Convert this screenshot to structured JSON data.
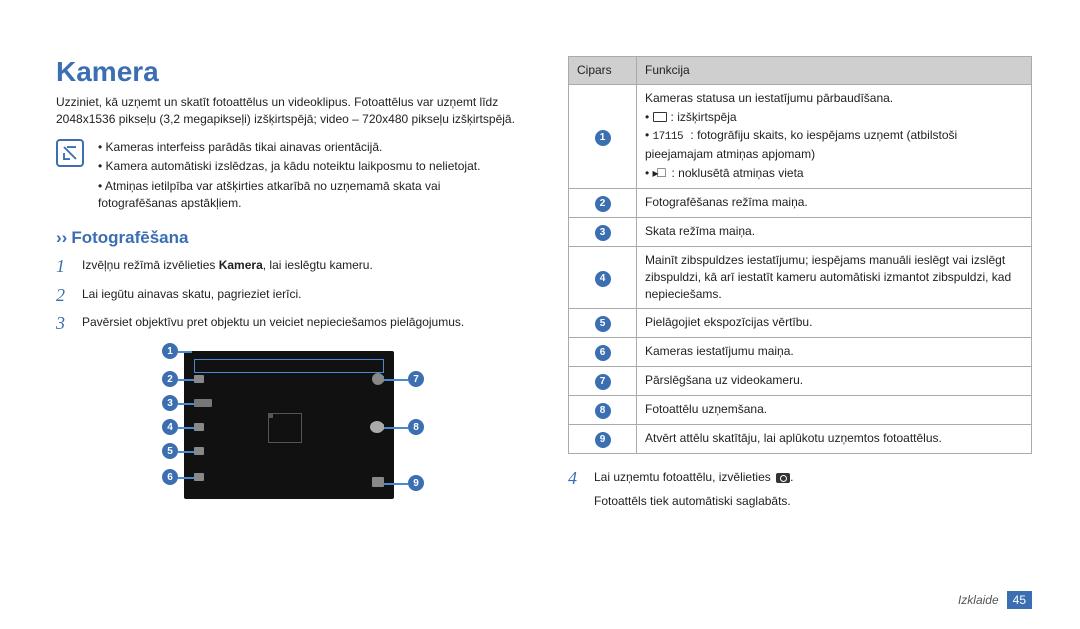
{
  "title": "Kamera",
  "intro": "Uzziniet, kā uzņemt un skatīt fotoattēlus un videoklipus. Fotoattēlus var uzņemt līdz 2048x1536 pikseļu (3,2 megapikseļi) izšķirtspējā; video – 720x480 pikseļu izšķirtspējā.",
  "notes": [
    "Kameras interfeiss parādās tikai ainavas orientācijā.",
    "Kamera automātiski izslēdzas, ja kādu noteiktu laikposmu to nelietojat.",
    "Atmiņas ietilpība var atšķirties atkarībā no uzņemamā skata vai fotografēšanas apstākļiem."
  ],
  "section_title": "Fotografēšana",
  "steps": {
    "s1_num": "1",
    "s1_a": "Izvēļņu režīmā izvēlieties ",
    "s1_bold": "Kamera",
    "s1_b": ", lai ieslēgtu kameru.",
    "s2_num": "2",
    "s2": "Lai iegūtu ainavas skatu, pagrieziet ierīci.",
    "s3_num": "3",
    "s3": "Pavērsiet objektīvu pret objektu un veiciet nepieciešamos pielāgojumus.",
    "s4_num": "4",
    "s4_a": "Lai uzņemtu fotoattēlu, izvēlieties ",
    "s4_b": ".",
    "s4_after": "Fotoattēls tiek automātiski saglabāts."
  },
  "table": {
    "h1": "Cipars",
    "h2": "Funkcija",
    "r1_badge": "1",
    "r1_main": "Kameras statusa un iestatījumu pārbaudīšana.",
    "r1_sub1_after": ": izšķirtspēja",
    "r1_sub2_num": "17115",
    "r1_sub2_after": " : fotogrāfiju skaits, ko iespējams uzņemt (atbilstoši pieejamajam atmiņas apjomam)",
    "r1_sub3_after": " : noklusētā atmiņas vieta",
    "r2_badge": "2",
    "r2": "Fotografēšanas režīma maiņa.",
    "r3_badge": "3",
    "r3": "Skata režīma maiņa.",
    "r4_badge": "4",
    "r4": "Mainīt zibspuldzes iestatījumu; iespējams manuāli ieslēgt vai izslēgt zibspuldzi, kā arī iestatīt kameru automātiski izmantot zibspuldzi, kad nepieciešams.",
    "r5_badge": "5",
    "r5": "Pielāgojiet ekspozīcijas vērtību.",
    "r6_badge": "6",
    "r6": "Kameras iestatījumu maiņa.",
    "r7_badge": "7",
    "r7": "Pārslēgšana uz videokameru.",
    "r8_badge": "8",
    "r8": "Fotoattēlu uzņemšana.",
    "r9_badge": "9",
    "r9": "Atvērt attēlu skatītāju, lai aplūkotu uzņemtos fotoattēlus."
  },
  "diagram": {
    "b1": "1",
    "b2": "2",
    "b3": "3",
    "b4": "4",
    "b5": "5",
    "b6": "6",
    "b7": "7",
    "b8": "8",
    "b9": "9"
  },
  "footer": {
    "label": "Izklaide",
    "page": "45"
  }
}
